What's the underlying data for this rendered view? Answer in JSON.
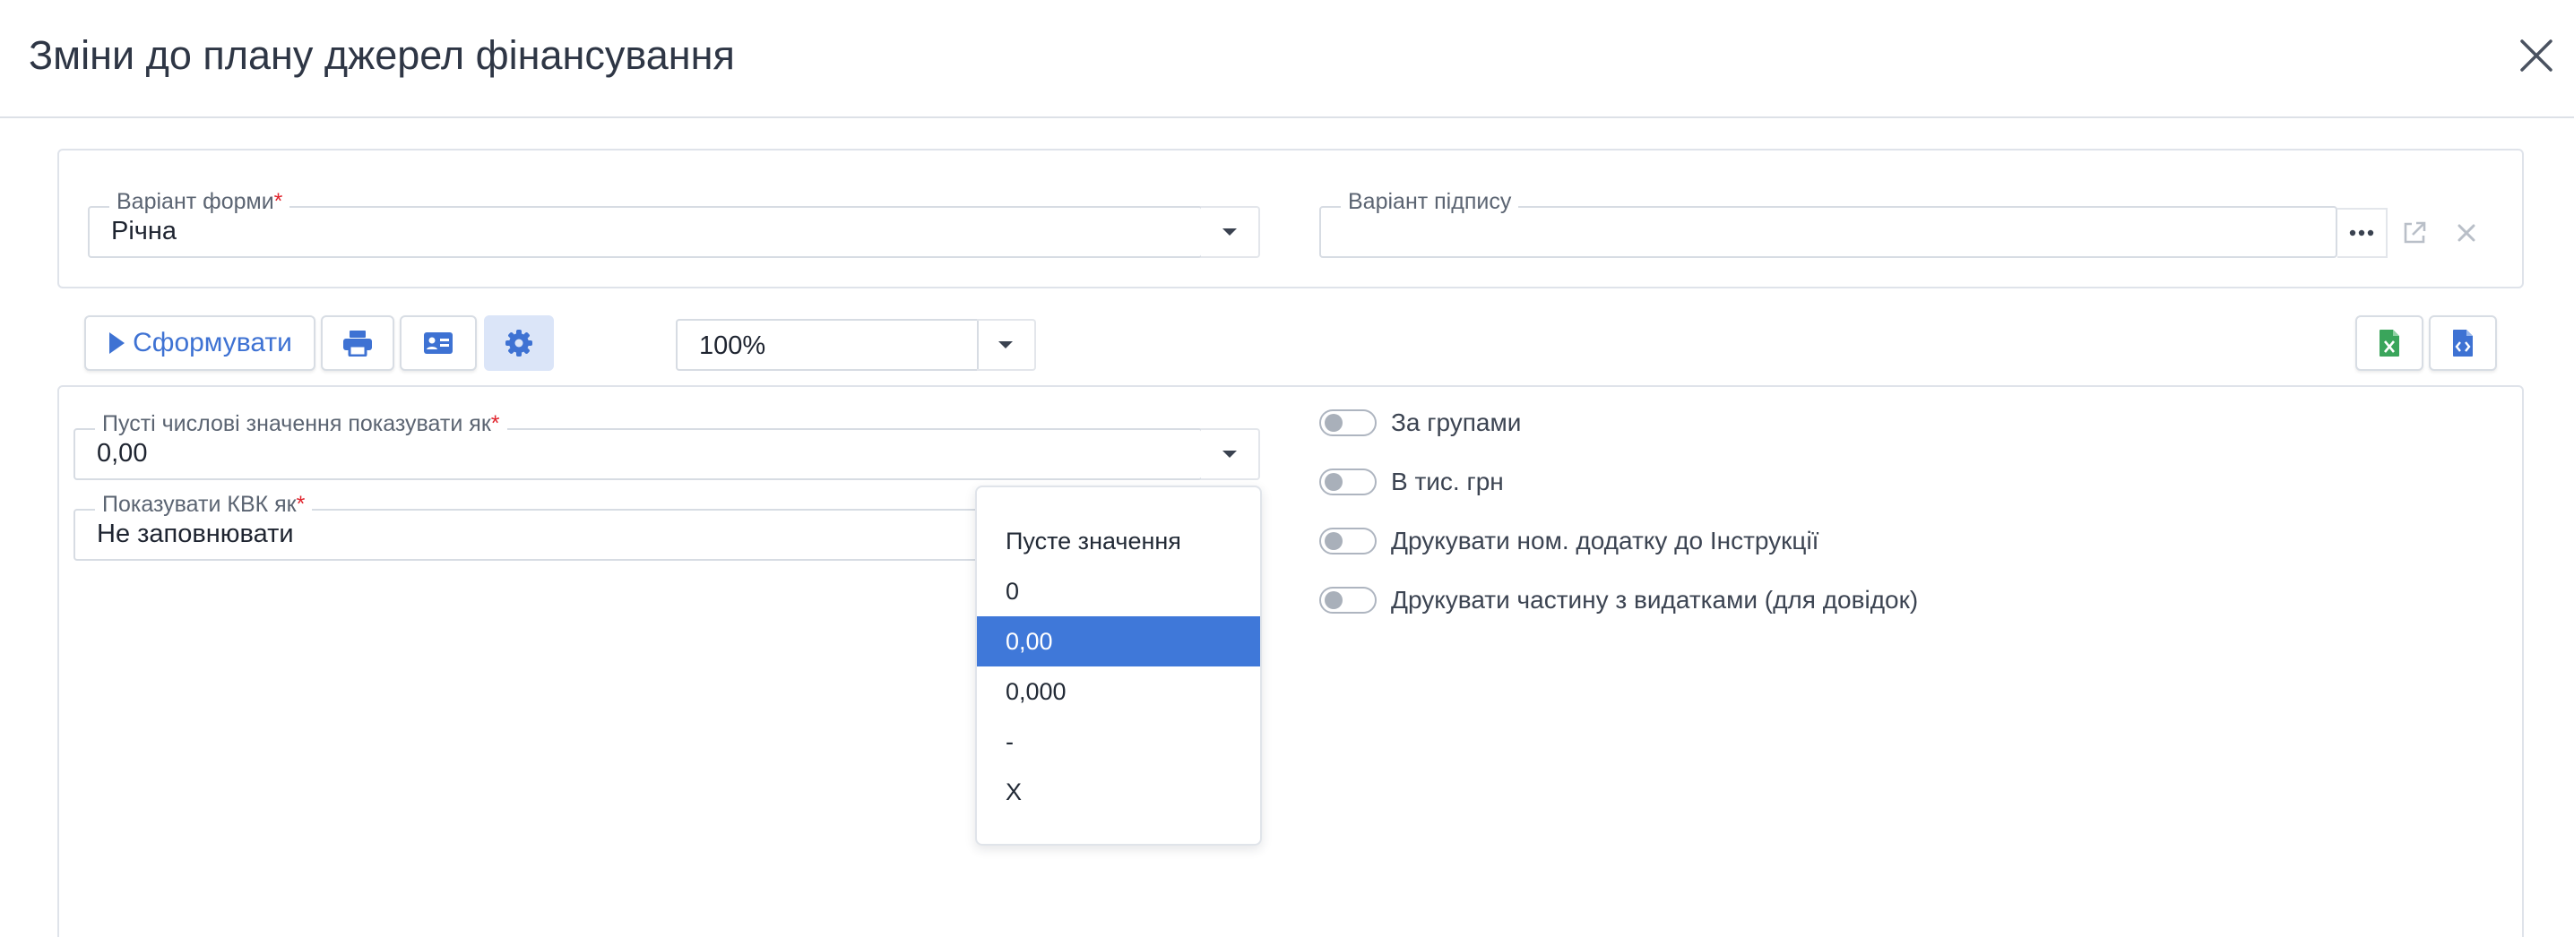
{
  "header": {
    "title": "Зміни до плану джерел фінансування",
    "close_icon": "close-icon"
  },
  "top_panel": {
    "form_variant": {
      "label": "Варіант форми",
      "required": "*",
      "value": "Річна"
    },
    "signature_variant": {
      "label": "Варіант підпису",
      "value": "",
      "more_icon": "ellipsis-icon",
      "open_icon": "external-link-icon",
      "clear_icon": "clear-icon"
    }
  },
  "toolbar": {
    "generate_label": "Сформувати",
    "generate_icon": "play-icon",
    "print_icon": "printer-icon",
    "card_icon": "id-card-icon",
    "settings_icon": "gear-icon",
    "zoom": "100%",
    "excel_icon": "excel-file-icon",
    "code_icon": "code-file-icon"
  },
  "settings": {
    "empty_numbers": {
      "label": "Пусті числові значення показувати як",
      "required": "*",
      "value": "0,00"
    },
    "kvk": {
      "label": "Показувати КВК як",
      "required": "*",
      "value": "Не заповнювати"
    },
    "toggles": [
      {
        "label": "За групами",
        "checked": false
      },
      {
        "label": "В тис. грн",
        "checked": false
      },
      {
        "label": "Друкувати ном. додатку до Інструкції",
        "checked": false
      },
      {
        "label": "Друкувати частину з видатками (для довідок)",
        "checked": false
      }
    ]
  },
  "dropdown": {
    "options": [
      "Пусте значення",
      "0",
      "0,00",
      "0,000",
      "-",
      "X"
    ],
    "selected": "0,00"
  },
  "colors": {
    "accent": "#3f78d9",
    "required": "#e0242d",
    "excel": "#3aa55b"
  }
}
